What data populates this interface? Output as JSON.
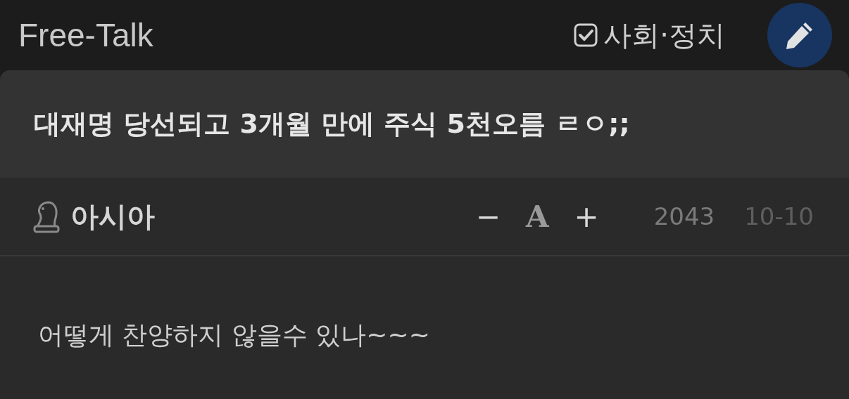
{
  "header": {
    "title": "Free-Talk",
    "category": {
      "label": "사회·정치",
      "checked": true
    }
  },
  "post": {
    "title": "대재명 당선되고 3개월 만에 주식 5천오름 ㄹㅇ;;",
    "author": "아시아",
    "font_controls": [
      "−",
      "A",
      "+"
    ],
    "views": "2043",
    "date": "10-10",
    "body": "어떻게 찬양하지 않을수 있나~~~"
  }
}
